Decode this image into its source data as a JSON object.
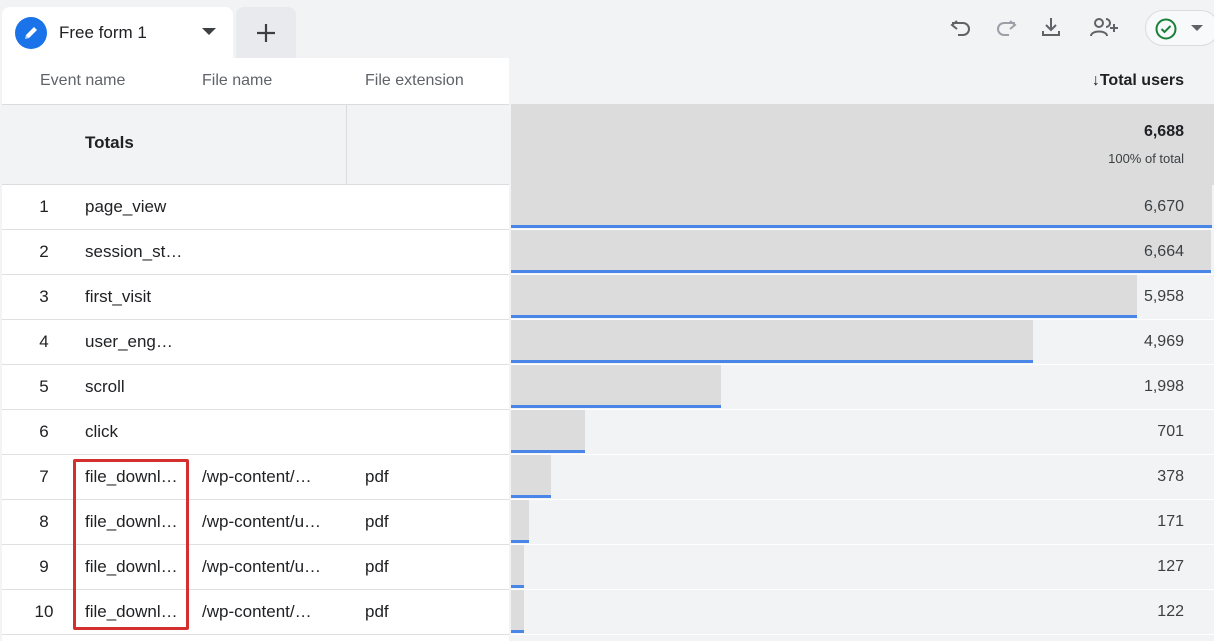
{
  "tab": {
    "label": "Free form 1"
  },
  "toolbar": {
    "undo": "undo-icon",
    "redo": "redo-icon",
    "download": "download-icon",
    "share": "share-users-icon"
  },
  "table": {
    "headers": {
      "event_name": "Event name",
      "file_name": "File name",
      "file_extension": "File extension",
      "total_users": "Total users"
    },
    "totals": {
      "label": "Totals",
      "value": "6,688",
      "percent": "100% of total"
    },
    "max_value": 6688,
    "rows": [
      {
        "index": "1",
        "event": "page_view",
        "file": "",
        "ext": "",
        "value": "6,670",
        "num": 6670
      },
      {
        "index": "2",
        "event": "session_st…",
        "file": "",
        "ext": "",
        "value": "6,664",
        "num": 6664
      },
      {
        "index": "3",
        "event": "first_visit",
        "file": "",
        "ext": "",
        "value": "5,958",
        "num": 5958
      },
      {
        "index": "4",
        "event": "user_eng…",
        "file": "",
        "ext": "",
        "value": "4,969",
        "num": 4969
      },
      {
        "index": "5",
        "event": "scroll",
        "file": "",
        "ext": "",
        "value": "1,998",
        "num": 1998
      },
      {
        "index": "6",
        "event": "click",
        "file": "",
        "ext": "",
        "value": "701",
        "num": 701
      },
      {
        "index": "7",
        "event": "file_downl…",
        "file": "/wp-content/…",
        "ext": "pdf",
        "value": "378",
        "num": 378
      },
      {
        "index": "8",
        "event": "file_downl…",
        "file": "/wp-content/u…",
        "ext": "pdf",
        "value": "171",
        "num": 171
      },
      {
        "index": "9",
        "event": "file_downl…",
        "file": "/wp-content/u…",
        "ext": "pdf",
        "value": "127",
        "num": 127
      },
      {
        "index": "10",
        "event": "file_downl…",
        "file": "/wp-content/…",
        "ext": "pdf",
        "value": "122",
        "num": 122
      }
    ]
  },
  "colors": {
    "accent": "#1a73e8",
    "bar": "#dcdcdc",
    "bar_line": "#4a86e8",
    "highlight": "#d32f2f",
    "status_ok": "#188038"
  }
}
